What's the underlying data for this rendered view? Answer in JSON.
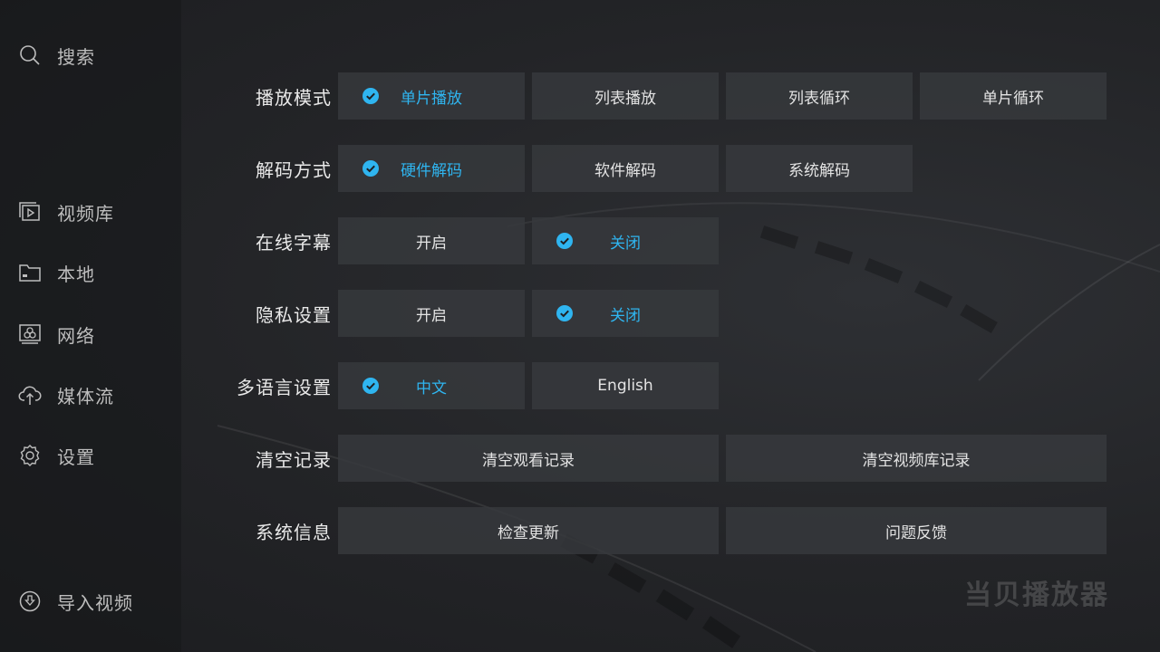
{
  "sidebar": {
    "search": {
      "label": "搜索",
      "icon": "search-icon"
    },
    "items": [
      {
        "label": "视频库",
        "icon": "video-library-icon"
      },
      {
        "label": "本地",
        "icon": "folder-icon"
      },
      {
        "label": "网络",
        "icon": "network-icon"
      },
      {
        "label": "媒体流",
        "icon": "cloud-upload-icon"
      },
      {
        "label": "设置",
        "icon": "gear-icon"
      }
    ],
    "import": {
      "label": "导入视频",
      "icon": "download-circle-icon"
    }
  },
  "settings": {
    "play_mode": {
      "label": "播放模式",
      "options": [
        "单片播放",
        "列表播放",
        "列表循环",
        "单片循环"
      ],
      "selected": "单片播放"
    },
    "decode": {
      "label": "解码方式",
      "options": [
        "硬件解码",
        "软件解码",
        "系统解码"
      ],
      "selected": "硬件解码"
    },
    "subtitles": {
      "label": "在线字幕",
      "options": [
        "开启",
        "关闭"
      ],
      "selected": "关闭"
    },
    "privacy": {
      "label": "隐私设置",
      "options": [
        "开启",
        "关闭"
      ],
      "selected": "关闭"
    },
    "language": {
      "label": "多语言设置",
      "options": [
        "中文",
        "English"
      ],
      "selected": "中文"
    },
    "clear": {
      "label": "清空记录",
      "options": [
        "清空观看记录",
        "清空视频库记录"
      ]
    },
    "system": {
      "label": "系统信息",
      "options": [
        "检查更新",
        "问题反馈"
      ]
    }
  },
  "brand": "当贝播放器",
  "colors": {
    "accent": "#2fb5f0",
    "background": "#1f2023",
    "option_bg": "#37393d",
    "text": "#e3e3e3"
  }
}
